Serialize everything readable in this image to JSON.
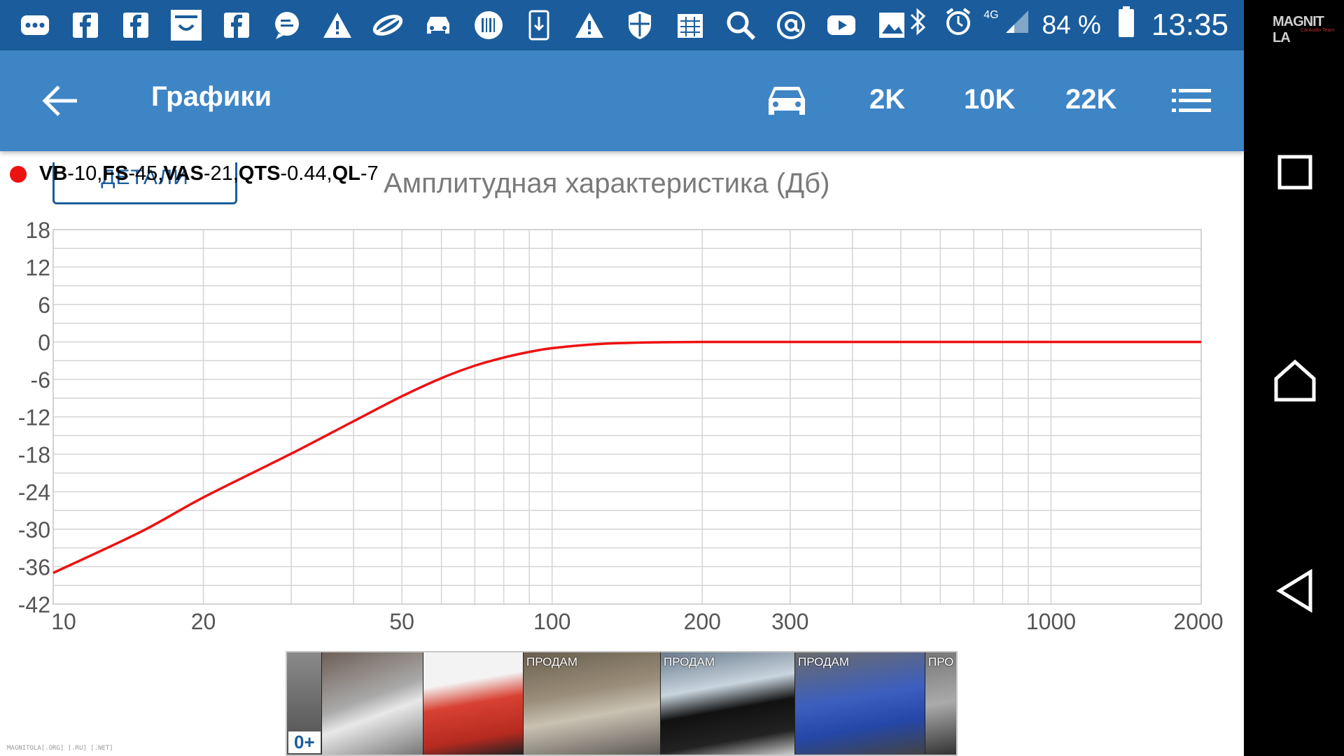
{
  "status_bar": {
    "icons": [
      "more-icon",
      "facebook-icon",
      "facebook-icon",
      "shopping-bag-icon",
      "facebook-icon",
      "chat-icon",
      "warning-icon",
      "link-icon",
      "car-service-icon",
      "barcode-icon",
      "download-icon",
      "warning-icon",
      "shield-icon",
      "calendar-icon",
      "search-icon",
      "at-sign-icon",
      "youtube-icon",
      "image-icon"
    ],
    "network": "4G",
    "battery": "84 %",
    "time": "13:35"
  },
  "toolbar": {
    "title": "Графики",
    "btn_2k": "2K",
    "btn_10k": "10K",
    "btn_22k": "22K"
  },
  "chart_header": {
    "details_label": "ДЕТАЛИ",
    "legend_parts": {
      "vb_key": "VB",
      "vb_val": "-10, ",
      "fs_key": "FS",
      "fs_val": "-45, ",
      "vas_key": "VAS",
      "vas_val": "-21, ",
      "qts_key": "QTS",
      "qts_val": "-0.44, ",
      "ql_key": "QL",
      "ql_val": "-7"
    }
  },
  "chart_data": {
    "type": "line",
    "title": "Амплитудная характеристика (Дб)",
    "xscale": "log",
    "xlim": [
      10,
      2000
    ],
    "ylim": [
      -42,
      18
    ],
    "yticks": [
      18,
      12,
      6,
      0,
      -6,
      -12,
      -18,
      -24,
      -30,
      -36,
      -42
    ],
    "xtick_labels": [
      "10",
      "20",
      "50",
      "100",
      "200",
      "300",
      "1000",
      "2000"
    ],
    "xtick_values": [
      10,
      20,
      50,
      100,
      200,
      300,
      1000,
      2000
    ],
    "grid": true,
    "series": [
      {
        "name": "VB-10, FS-45, VAS-21, QTS-0.44, QL-7",
        "color": "#ee1111",
        "x": [
          10,
          15,
          20,
          30,
          40,
          50,
          60,
          70,
          80,
          90,
          100,
          120,
          150,
          200,
          300,
          500,
          1000,
          2000
        ],
        "y": [
          -37,
          -30.4,
          -24.9,
          -17.9,
          -12.7,
          -8.7,
          -5.8,
          -3.8,
          -2.5,
          -1.6,
          -1.0,
          -0.4,
          -0.1,
          0,
          0,
          0,
          0,
          0
        ]
      }
    ]
  },
  "ad": {
    "tags": [
      "ПРОДАМ",
      "ПРОДАМ",
      "ПРОДАМ",
      "ПРО"
    ],
    "age_rating": "0+"
  },
  "watermark": {
    "bottom": "MAGNITOLA[.ORG] [.RU] [.NET]",
    "brand": "MAGNIT LA",
    "brand_sub": "CarAudio Team"
  },
  "colors": {
    "status_bar": "#1b5d9c",
    "toolbar": "#3e85c6",
    "series": "#ee1111"
  }
}
